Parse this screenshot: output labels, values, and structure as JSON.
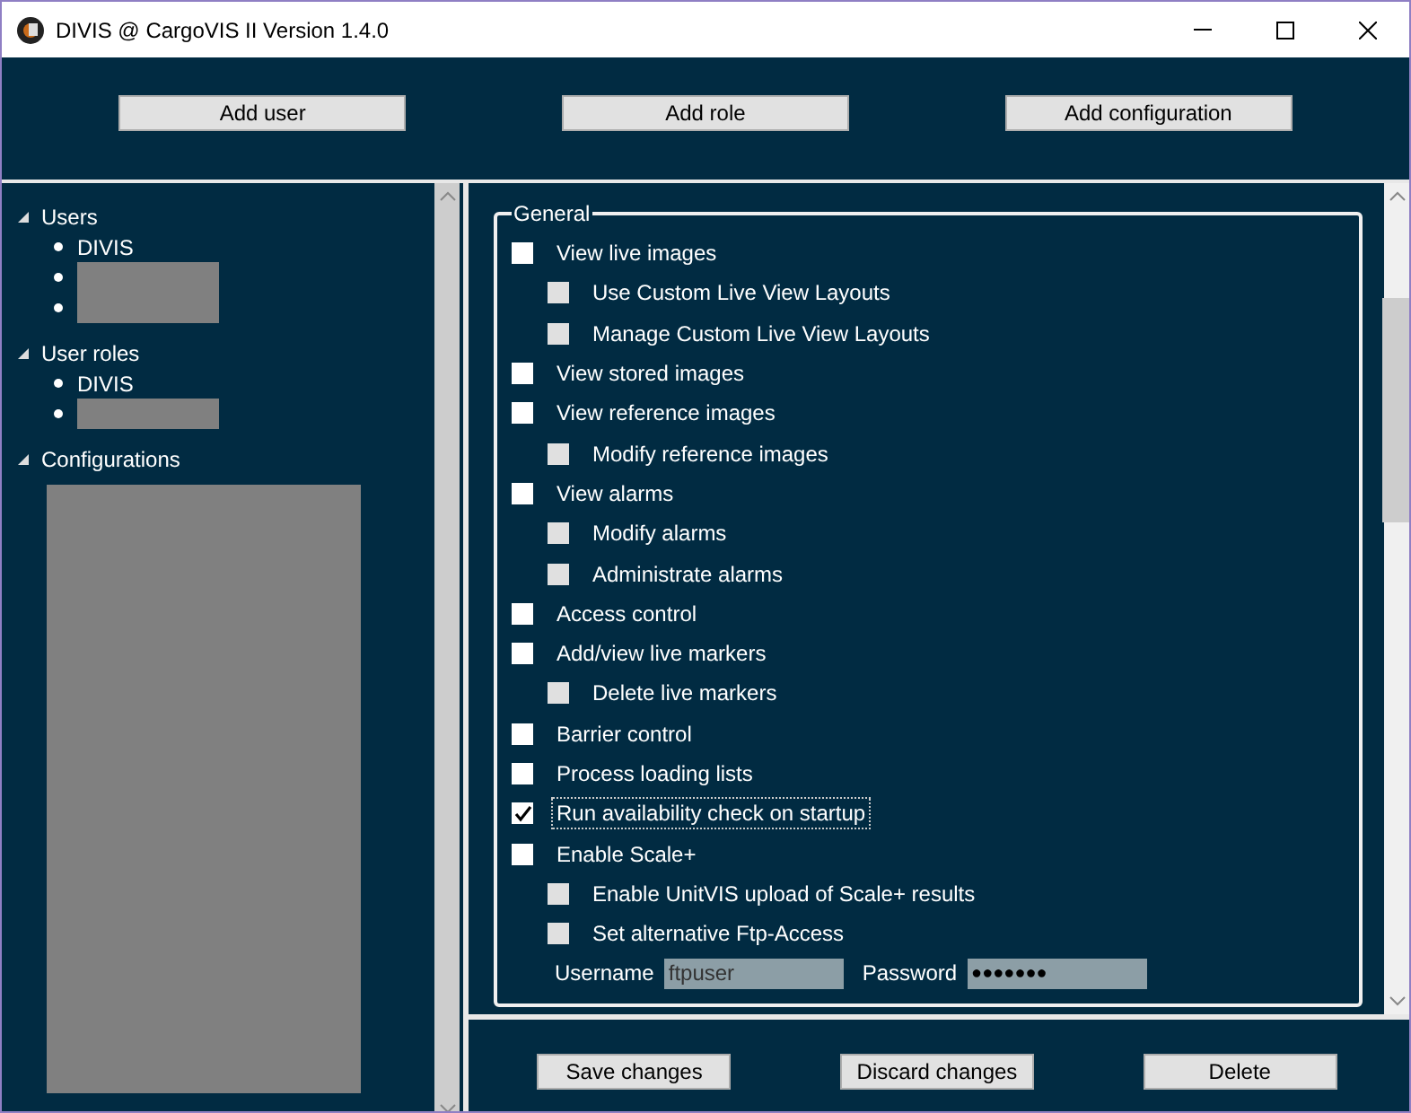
{
  "window": {
    "title": "DIVIS @ CargoVIS II Version 1.4.0"
  },
  "toolbar": {
    "buttons": [
      "Add user",
      "Add role",
      "Add configuration"
    ]
  },
  "tree": [
    {
      "label": "Users",
      "expanded": true,
      "children": [
        {
          "kind": "text",
          "label": "DIVIS"
        },
        {
          "kind": "redacted"
        },
        {
          "kind": "redacted"
        }
      ]
    },
    {
      "label": "User roles",
      "expanded": true,
      "children": [
        {
          "kind": "text",
          "label": "DIVIS"
        },
        {
          "kind": "redacted"
        }
      ]
    },
    {
      "label": "Configurations",
      "expanded": true,
      "children": [
        {
          "kind": "block"
        }
      ]
    }
  ],
  "group": {
    "title": "General",
    "options": [
      {
        "label": "View live images",
        "checked": false,
        "disabled": false,
        "focused": false,
        "children": [
          {
            "label": "Use Custom Live View Layouts",
            "checked": false,
            "disabled": true
          },
          {
            "label": "Manage Custom Live View Layouts",
            "checked": false,
            "disabled": true
          }
        ]
      },
      {
        "label": "View stored images",
        "checked": false,
        "disabled": false,
        "focused": false
      },
      {
        "label": "View reference images",
        "checked": false,
        "disabled": false,
        "focused": false,
        "children": [
          {
            "label": "Modify reference images",
            "checked": false,
            "disabled": true
          }
        ]
      },
      {
        "label": "View alarms",
        "checked": false,
        "disabled": false,
        "focused": false,
        "children": [
          {
            "label": "Modify alarms",
            "checked": false,
            "disabled": true
          },
          {
            "label": "Administrate alarms",
            "checked": false,
            "disabled": true
          }
        ]
      },
      {
        "label": "Access control",
        "checked": false,
        "disabled": false,
        "focused": false
      },
      {
        "label": "Add/view live markers",
        "checked": false,
        "disabled": false,
        "focused": false,
        "children": [
          {
            "label": "Delete live markers",
            "checked": false,
            "disabled": true
          }
        ]
      },
      {
        "label": "Barrier control",
        "checked": false,
        "disabled": false,
        "focused": false
      },
      {
        "label": "Process loading lists",
        "checked": false,
        "disabled": false,
        "focused": false
      },
      {
        "label": "Run availability check on startup",
        "checked": true,
        "disabled": false,
        "focused": true
      },
      {
        "label": "Enable Scale+",
        "checked": false,
        "disabled": false,
        "focused": false,
        "children": [
          {
            "label": "Enable UnitVIS upload of Scale+ results",
            "checked": false,
            "disabled": true
          },
          {
            "label": "Set alternative Ftp-Access",
            "checked": false,
            "disabled": true
          }
        ]
      }
    ],
    "credentials": [
      {
        "label": "Username",
        "value": "ftpuser",
        "kind": "text"
      },
      {
        "label": "Password",
        "value": "●●●●●●●",
        "kind": "password"
      }
    ]
  },
  "footer": {
    "buttons": [
      "Save changes",
      "Discard changes",
      "Delete"
    ]
  }
}
